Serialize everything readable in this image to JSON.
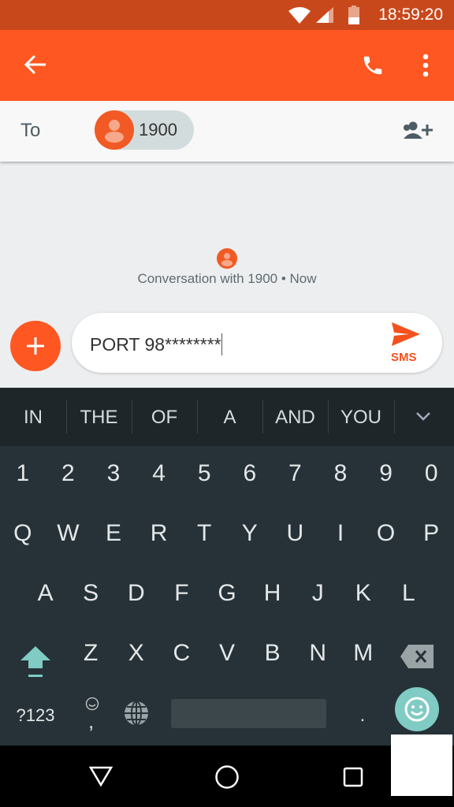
{
  "status_bar": {
    "time": "18:59:20",
    "icons": [
      "wifi-icon",
      "signal-icon",
      "battery-icon"
    ]
  },
  "app_bar": {
    "icons": [
      "back-arrow-icon",
      "phone-icon",
      "more-vert-icon"
    ]
  },
  "recipient": {
    "to_label": "To",
    "chip_number": "1900",
    "add_icon": "add-person-icon"
  },
  "conversation": {
    "info": "Conversation with 1900 • Now"
  },
  "composer": {
    "text": "PORT 98********",
    "send_label": "SMS"
  },
  "suggestions": [
    "IN",
    "THE",
    "OF",
    "A",
    "AND",
    "YOU"
  ],
  "keyboard": {
    "rows": [
      [
        "1",
        "2",
        "3",
        "4",
        "5",
        "6",
        "7",
        "8",
        "9",
        "0"
      ],
      [
        "Q",
        "W",
        "E",
        "R",
        "T",
        "Y",
        "U",
        "I",
        "O",
        "P"
      ],
      [
        "A",
        "S",
        "D",
        "F",
        "G",
        "H",
        "J",
        "K",
        "L"
      ],
      [
        "Z",
        "X",
        "C",
        "V",
        "B",
        "N",
        "M"
      ]
    ],
    "symbols_label": "?123",
    "comma_label": ",",
    "period_label": "."
  },
  "colors": {
    "primary": "#ff5722",
    "status": "#c9481b",
    "keyboard": "#263238",
    "accent": "#80cbc4"
  }
}
